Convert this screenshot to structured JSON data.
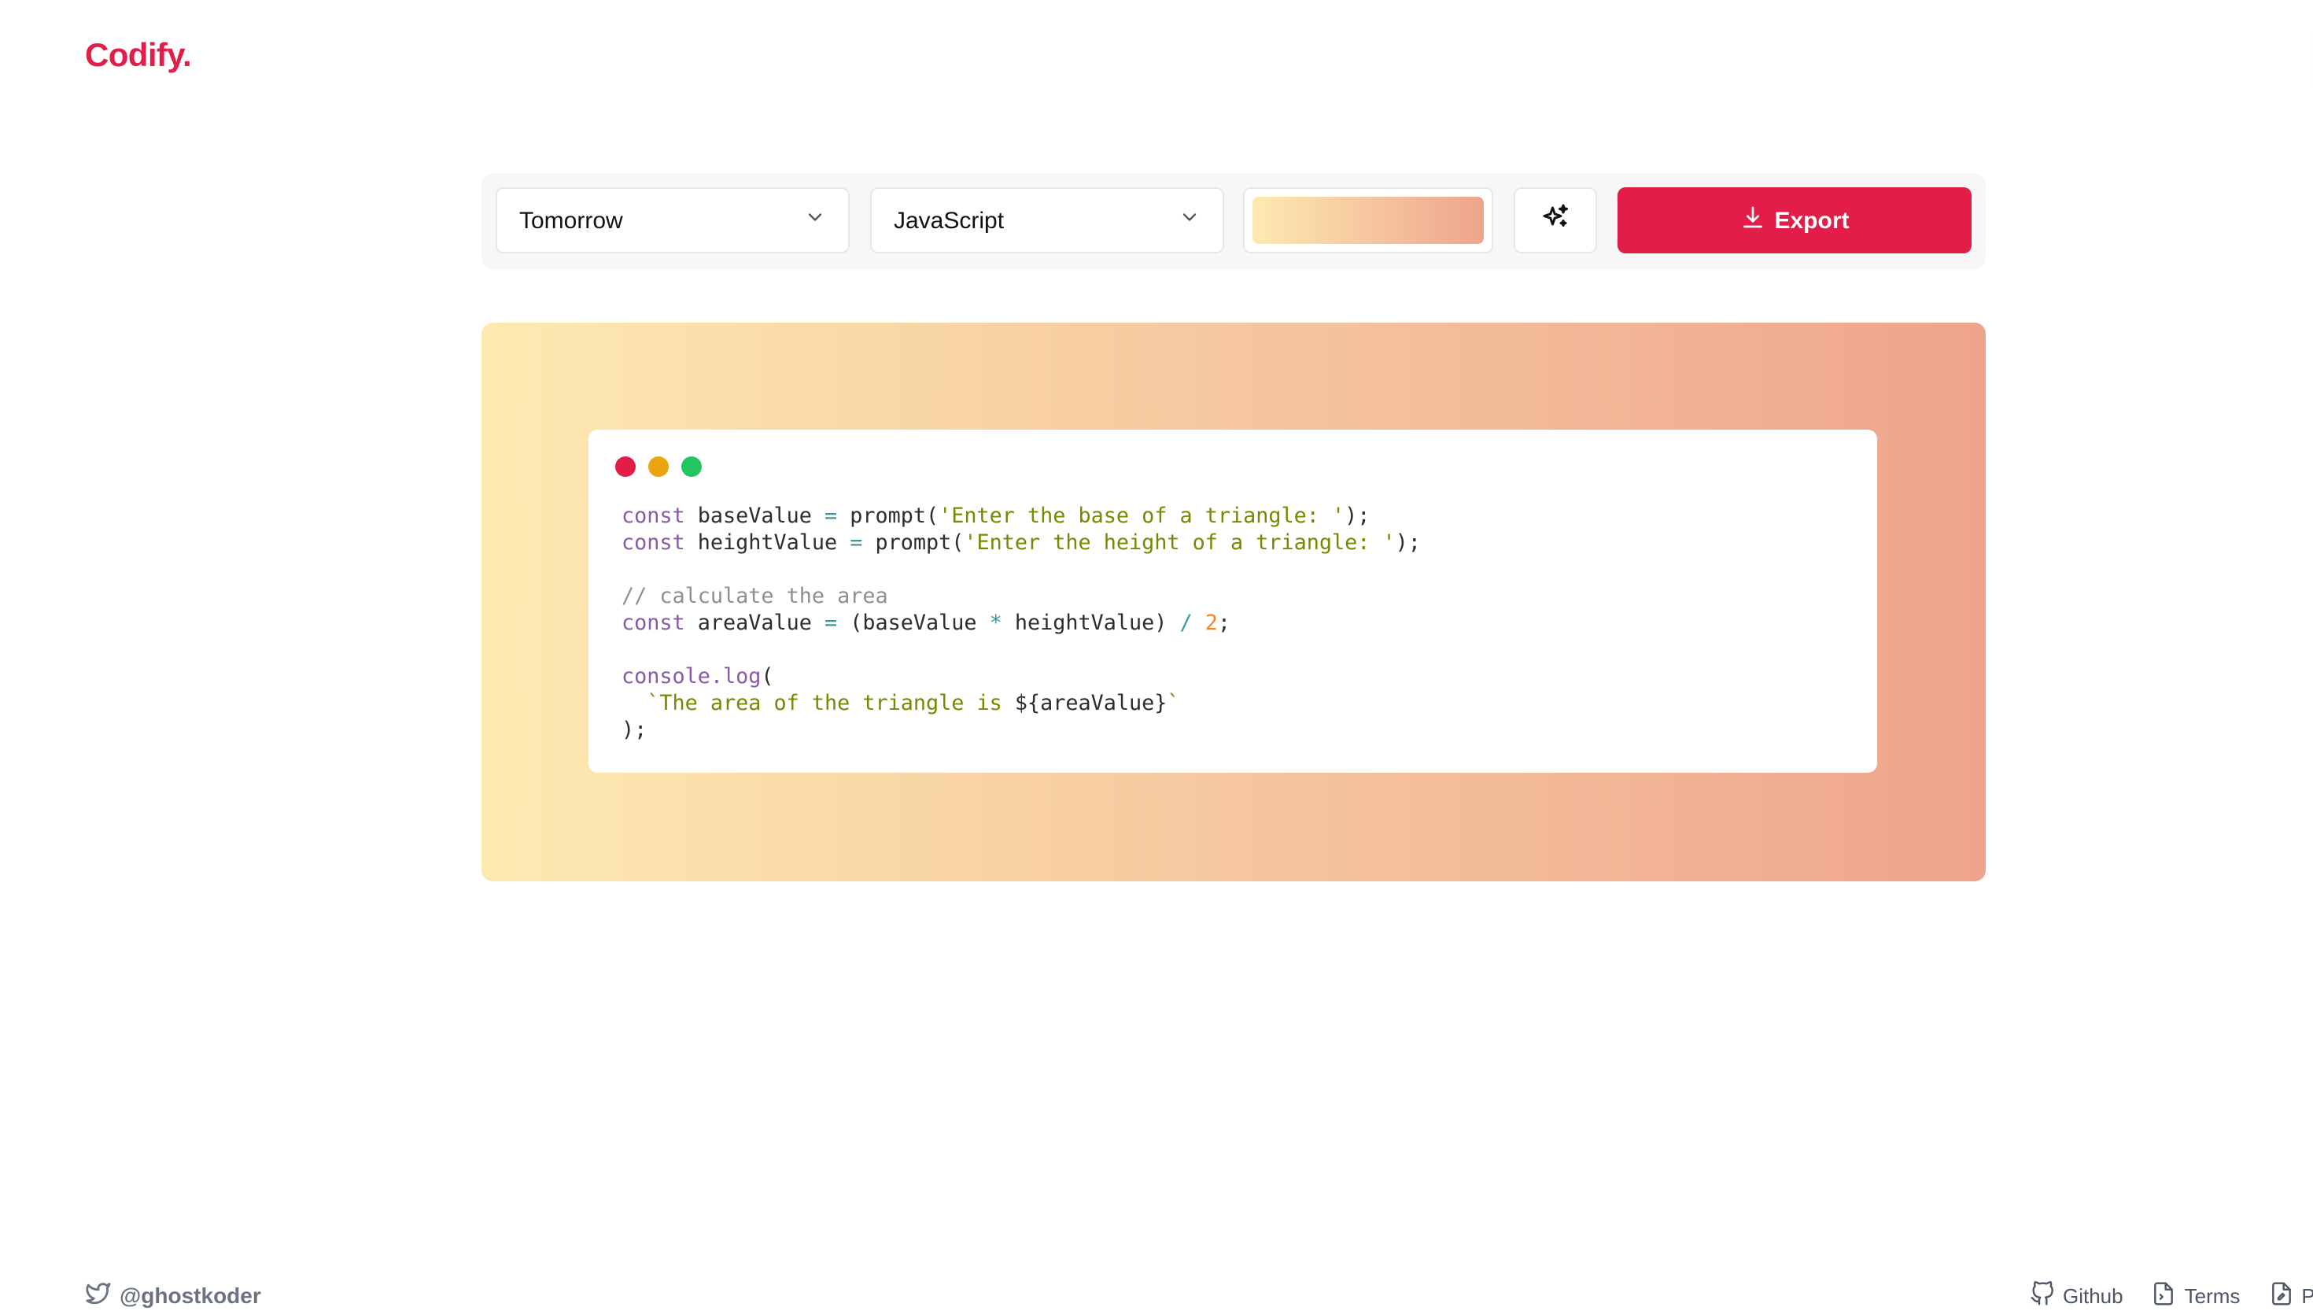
{
  "brand": {
    "logo": "Codify.",
    "accent": "#e11d48"
  },
  "header": {
    "theme_toggle_icon": "sun-icon"
  },
  "toolbar": {
    "theme_select": {
      "value": "Tomorrow",
      "icon": "chevron-down-icon"
    },
    "language_select": {
      "value": "JavaScript",
      "icon": "chevron-down-icon"
    },
    "background_picker": {
      "gradient_from": "#fdeab1",
      "gradient_to": "#eea48c"
    },
    "magic_button_icon": "sparkles-icon",
    "export_button": {
      "label": "Export",
      "icon": "download-icon",
      "color": "#e11d48"
    }
  },
  "editor": {
    "window_dots": [
      "#e11d48",
      "#eaa50e",
      "#22c55e"
    ],
    "code_lines": [
      [
        {
          "t": "keyword",
          "v": "const"
        },
        {
          "t": "plain",
          "v": " baseValue "
        },
        {
          "t": "op",
          "v": "="
        },
        {
          "t": "plain",
          "v": " prompt("
        },
        {
          "t": "string",
          "v": "'Enter the base of a triangle: '"
        },
        {
          "t": "plain",
          "v": ");"
        }
      ],
      [
        {
          "t": "keyword",
          "v": "const"
        },
        {
          "t": "plain",
          "v": " heightValue "
        },
        {
          "t": "op",
          "v": "="
        },
        {
          "t": "plain",
          "v": " prompt("
        },
        {
          "t": "string",
          "v": "'Enter the height of a triangle: '"
        },
        {
          "t": "plain",
          "v": ");"
        }
      ],
      [],
      [
        {
          "t": "comment",
          "v": "// calculate the area"
        }
      ],
      [
        {
          "t": "keyword",
          "v": "const"
        },
        {
          "t": "plain",
          "v": " areaValue "
        },
        {
          "t": "op",
          "v": "="
        },
        {
          "t": "plain",
          "v": " (baseValue "
        },
        {
          "t": "op",
          "v": "*"
        },
        {
          "t": "plain",
          "v": " heightValue) "
        },
        {
          "t": "op",
          "v": "/"
        },
        {
          "t": "plain",
          "v": " "
        },
        {
          "t": "number",
          "v": "2"
        },
        {
          "t": "plain",
          "v": ";"
        }
      ],
      [],
      [
        {
          "t": "builtin",
          "v": "console.log"
        },
        {
          "t": "plain",
          "v": "("
        }
      ],
      [
        {
          "t": "string",
          "v": "  `The area of the triangle is "
        },
        {
          "t": "plain",
          "v": "${areaValue}"
        },
        {
          "t": "string",
          "v": "`"
        }
      ],
      [
        {
          "t": "plain",
          "v": ");"
        }
      ]
    ]
  },
  "footer": {
    "twitter": {
      "icon": "twitter-icon",
      "handle": "@ghostkoder"
    },
    "links": [
      {
        "icon": "github-icon",
        "label": "Github"
      },
      {
        "icon": "terms-file-icon",
        "label": "Terms"
      },
      {
        "icon": "privacy-file-icon",
        "label": "Privacy"
      }
    ]
  }
}
